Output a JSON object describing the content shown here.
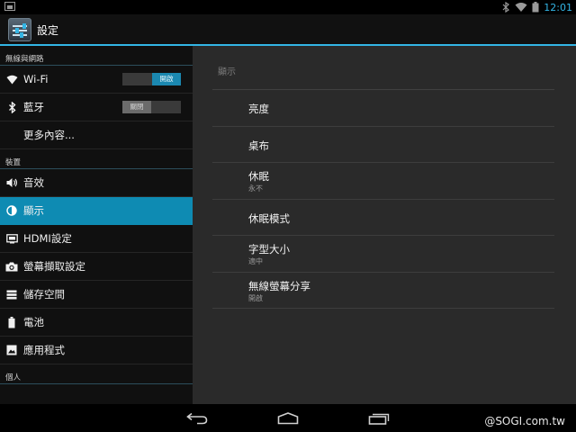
{
  "status_bar": {
    "time": "12:01",
    "accent": "#33b5e5"
  },
  "action_bar": {
    "title": "設定",
    "icon": "settings-app-icon"
  },
  "left_pane": {
    "sections": [
      {
        "header": "無線與網路"
      },
      {
        "header": "裝置"
      },
      {
        "header": "個人"
      }
    ],
    "wireless_items": [
      {
        "label": "Wi-Fi",
        "icon": "wifi-icon",
        "toggle": "開啟"
      },
      {
        "label": "藍牙",
        "icon": "bluetooth-icon",
        "toggle": "關閉"
      },
      {
        "label": "更多內容..."
      }
    ],
    "device_items": [
      {
        "label": "音效",
        "icon": "speaker-icon"
      },
      {
        "label": "顯示",
        "icon": "display-icon",
        "selected": true
      },
      {
        "label": "HDMI設定",
        "icon": "hdmi-icon"
      },
      {
        "label": "螢幕擷取設定",
        "icon": "camera-icon"
      },
      {
        "label": "儲存空間",
        "icon": "storage-icon"
      },
      {
        "label": "電池",
        "icon": "battery-icon"
      },
      {
        "label": "應用程式",
        "icon": "apps-icon"
      }
    ],
    "selected_color": "#0e8bb3"
  },
  "right_pane": {
    "title": "顯示",
    "items": [
      {
        "title": "亮度"
      },
      {
        "title": "桌布"
      },
      {
        "title": "休眠",
        "summary": "永不"
      },
      {
        "title": "休眠模式"
      },
      {
        "title": "字型大小",
        "summary": "適中"
      },
      {
        "title": "無線螢幕分享",
        "summary": "開啟"
      }
    ]
  },
  "nav_bar": {
    "buttons": [
      "back-icon",
      "home-icon",
      "recent-apps-icon"
    ],
    "watermark": "@SOGI.com.tw"
  }
}
